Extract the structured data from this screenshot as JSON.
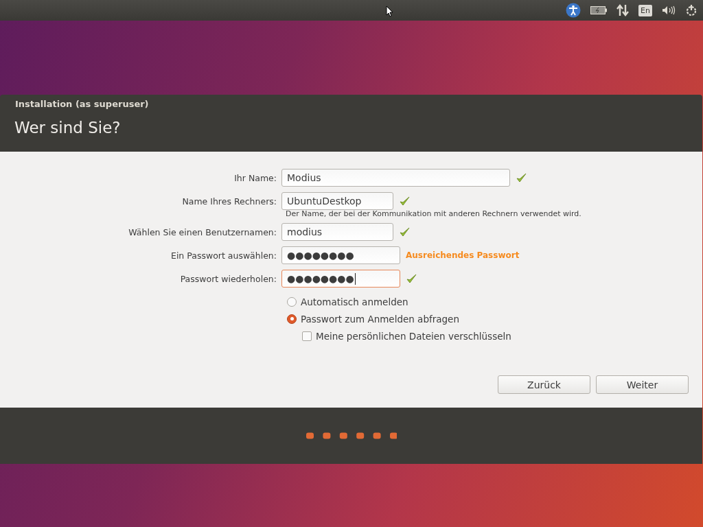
{
  "top_panel": {
    "keyboard_layout": "En"
  },
  "window": {
    "title": "Installation (as superuser)",
    "heading": "Wer sind Sie?"
  },
  "fields": [
    {
      "label": "Ihr Name:",
      "value": "Modius",
      "focused": false,
      "valid": true
    },
    {
      "label": "Name Ihres Rechners:",
      "value": "UbuntuDestkop",
      "focused": false,
      "valid": true,
      "hint": "Der Name, der bei der Kommunikation mit anderen Rechnern verwendet wird."
    },
    {
      "label": "Wählen Sie einen Benutzernamen:",
      "value": "modius",
      "focused": false,
      "valid": true
    },
    {
      "label": "Ein Passwort auswählen:",
      "value": "●●●●●●●●",
      "focused": false,
      "valid": false,
      "strength": "Ausreichendes Passwort"
    },
    {
      "label": "Passwort wiederholen:",
      "value": "●●●●●●●●",
      "focused": true,
      "valid": true
    }
  ],
  "login_options": [
    {
      "label": "Automatisch anmelden",
      "selected": false
    },
    {
      "label": "Passwort zum Anmelden abfragen",
      "selected": true
    }
  ],
  "encrypt": {
    "label": "Meine persönlichen Dateien verschlüsseln",
    "checked": false
  },
  "buttons": [
    "Zurück",
    "Weiter"
  ]
}
